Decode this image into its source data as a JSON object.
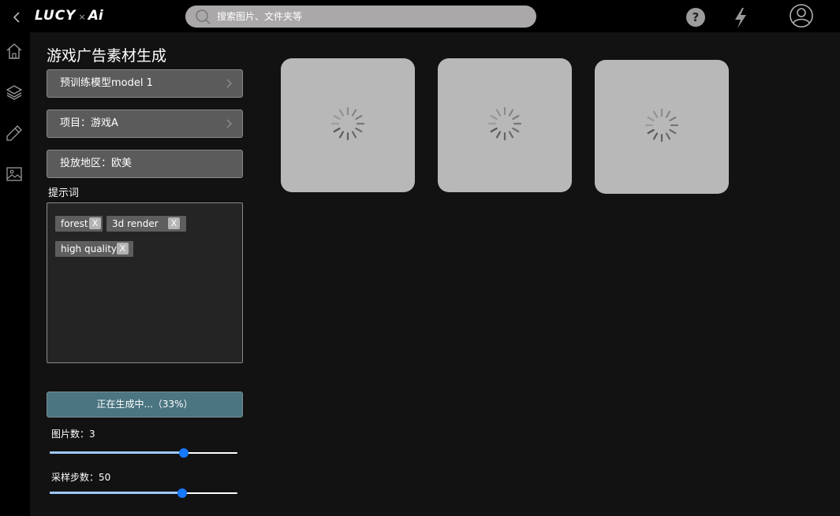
{
  "header": {
    "logo_left": "LUCY",
    "logo_sep": "×",
    "logo_right": "Ai",
    "search_placeholder": "搜索图片、文件夹等",
    "help_label": "?"
  },
  "sidebar": {
    "items": [
      {
        "icon": "home-icon"
      },
      {
        "icon": "layers-icon"
      },
      {
        "icon": "pencil-icon"
      },
      {
        "icon": "image-icon"
      }
    ]
  },
  "panel": {
    "title": "游戏广告素材生成",
    "model_select": "预训练模型model 1",
    "project_select": "项目：游戏A",
    "region_select": "投放地区：欧美",
    "prompt_label": "提示词",
    "tags": [
      "forest",
      "3d render",
      "high quality"
    ],
    "tag_remove_label": "X",
    "generate_button": "正在生成中...（33%）",
    "image_count_label": "图片数：3",
    "image_count": {
      "min": 0,
      "max": 4.2,
      "value": 3
    },
    "steps_label": "采样步数：50",
    "steps": {
      "min": 0,
      "max": 71,
      "value": 50
    }
  },
  "results": {
    "cards": [
      {
        "state": "loading"
      },
      {
        "state": "loading"
      },
      {
        "state": "loading"
      }
    ]
  }
}
